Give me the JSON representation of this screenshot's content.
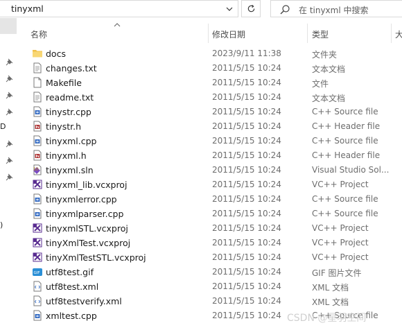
{
  "address": {
    "path": "tinyxml"
  },
  "search": {
    "placeholder": "在 tinyxml 中搜索"
  },
  "nav_fragments": [
    "D",
    ")"
  ],
  "columns": {
    "name": "名称",
    "date": "修改日期",
    "type": "类型",
    "size": "大"
  },
  "files": [
    {
      "name": "docs",
      "date": "2023/9/11 11:38",
      "type": "文件夹",
      "icon": "folder-icon"
    },
    {
      "name": "changes.txt",
      "date": "2011/5/15 10:24",
      "type": "文本文档",
      "icon": "text-file-icon"
    },
    {
      "name": "Makefile",
      "date": "2011/5/15 10:24",
      "type": "文件",
      "icon": "blank-file-icon"
    },
    {
      "name": "readme.txt",
      "date": "2011/5/15 10:24",
      "type": "文本文档",
      "icon": "text-file-icon"
    },
    {
      "name": "tinystr.cpp",
      "date": "2011/5/15 10:24",
      "type": "C++ Source file",
      "icon": "cpp-file-icon"
    },
    {
      "name": "tinystr.h",
      "date": "2011/5/15 10:24",
      "type": "C++ Header file",
      "icon": "header-file-icon"
    },
    {
      "name": "tinyxml.cpp",
      "date": "2011/5/15 10:24",
      "type": "C++ Source file",
      "icon": "cpp-file-icon"
    },
    {
      "name": "tinyxml.h",
      "date": "2011/5/15 10:24",
      "type": "C++ Header file",
      "icon": "header-file-icon"
    },
    {
      "name": "tinyxml.sln",
      "date": "2011/5/15 10:24",
      "type": "Visual Studio Sol...",
      "icon": "solution-file-icon"
    },
    {
      "name": "tinyxml_lib.vcxproj",
      "date": "2011/5/15 10:24",
      "type": "VC++ Project",
      "icon": "vcxproj-file-icon"
    },
    {
      "name": "tinyxmlerror.cpp",
      "date": "2011/5/15 10:24",
      "type": "C++ Source file",
      "icon": "cpp-file-icon"
    },
    {
      "name": "tinyxmlparser.cpp",
      "date": "2011/5/15 10:24",
      "type": "C++ Source file",
      "icon": "cpp-file-icon"
    },
    {
      "name": "tinyxmlSTL.vcxproj",
      "date": "2011/5/15 10:24",
      "type": "VC++ Project",
      "icon": "vcxproj-file-icon"
    },
    {
      "name": "tinyXmlTest.vcxproj",
      "date": "2011/5/15 10:24",
      "type": "VC++ Project",
      "icon": "vcxproj-file-icon"
    },
    {
      "name": "tinyXmlTestSTL.vcxproj",
      "date": "2011/5/15 10:24",
      "type": "VC++ Project",
      "icon": "vcxproj-file-icon"
    },
    {
      "name": "utf8test.gif",
      "date": "2011/5/15 10:24",
      "type": "GIF 图片文件",
      "icon": "gif-file-icon"
    },
    {
      "name": "utf8test.xml",
      "date": "2011/5/15 10:24",
      "type": "XML 文档",
      "icon": "xml-file-icon"
    },
    {
      "name": "utf8testverify.xml",
      "date": "2011/5/15 10:24",
      "type": "XML 文档",
      "icon": "xml-file-icon"
    },
    {
      "name": "xmltest.cpp",
      "date": "2011/5/15 10:24",
      "type": "C++ Source file",
      "icon": "cpp-file-icon"
    }
  ],
  "watermark": "CSDN @星羽空间"
}
